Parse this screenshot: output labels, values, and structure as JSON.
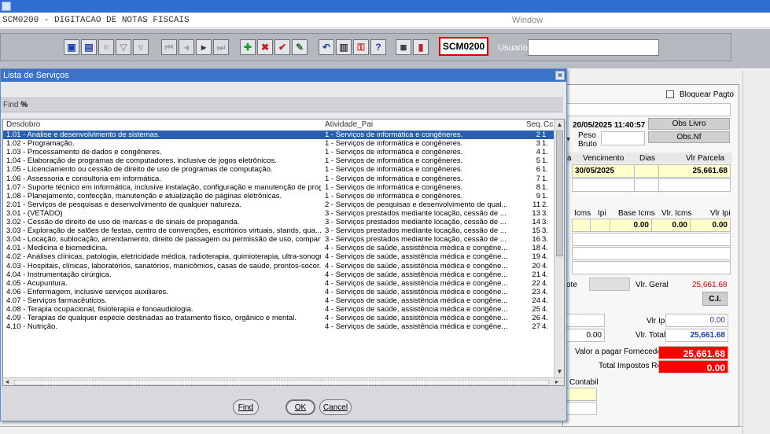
{
  "form": {
    "title": "SCM0200 - DIGITACAO DE NOTAS FISCAIS",
    "window_label": "Window",
    "code": "SCM0200",
    "usuario_label": "Usuario",
    "usuario_value": ""
  },
  "toolbar": {
    "buttons": [
      "save-icon",
      "print-icon",
      "list-icon",
      "filter-icon",
      "funnel-icon",
      "first-icon",
      "prev-icon",
      "next-icon",
      "last-icon",
      "add-icon",
      "delete-icon",
      "confirm-icon",
      "edit-icon",
      "undo-icon",
      "clipboard-icon",
      "key-icon",
      "help-icon",
      "menu-icon",
      "exit-icon"
    ]
  },
  "background": {
    "bloquear_label": "Bloquear Pagto",
    "datetime": "20/05/2025 11:40:57",
    "obs_livro": "Obs Livro",
    "obs_nf": "Obs.Nf",
    "peso": "Peso",
    "bruto": "Bruto",
    "vencimento_header": "Vencimento",
    "dias_header": "Dias",
    "vlr_parcela_header": "Vlr Parcela",
    "vencimento_value": "30/05/2025",
    "vlr_parcela_value": "25,661.68",
    "tax_headers": [
      "Icms",
      "Ipi",
      "Base Icms",
      "Vlr. Icms",
      "Vlr Ipi"
    ],
    "base_icms": "0.00",
    "vlr_icms": "0.00",
    "vlr_ipi_row": "0.00",
    "lote_fragment": "ote",
    "vlr_geral_label": "Vlr. Geral",
    "vlr_geral_value": "25,661.68",
    "ci_button": "C.I.",
    "vlr_ipi_label": "Vlr Ipi",
    "vlr_ipi_value": "0.00",
    "total_left": "0.00",
    "vlr_total_label": "Vlr. Total",
    "vlr_total_value": "25,661.68",
    "valor_pagar_label": "Valor a pagar Fornecedor",
    "valor_pagar_value": "25,661.68",
    "total_impostos_label": "Total Impostos Retido",
    "total_impostos_value": "0.00",
    "contabil_label": "Contabil"
  },
  "dialog": {
    "title": "Lista de Serviços",
    "close_icon": "close-icon",
    "find_label": "Find",
    "find_value": "%",
    "columns": [
      "Desdobro",
      "Atividade_Pai",
      "Seq.",
      "Cc"
    ],
    "rows": [
      {
        "desdobro": "1.01 - Análise e desenvolvimento de sistemas.",
        "atividade": "1 - Serviços de informática e congêneres.",
        "seq": "2",
        "cc": "1"
      },
      {
        "desdobro": "1.02 - Programação.",
        "atividade": "1 - Serviços de informática e congêneres.",
        "seq": "3",
        "cc": "1."
      },
      {
        "desdobro": "1.03 - Processamento de dados e congêneres.",
        "atividade": "1 - Serviços de informática e congêneres.",
        "seq": "4",
        "cc": "1."
      },
      {
        "desdobro": "1.04 - Elaboração de programas de computadores, inclusive de jogos eletrônicos.",
        "atividade": "1 - Serviços de informática e congêneres.",
        "seq": "5",
        "cc": "1."
      },
      {
        "desdobro": "1.05 - Licenciamento ou cessão de direito de uso de programas de computação.",
        "atividade": "1 - Serviços de informática e congêneres.",
        "seq": "6",
        "cc": "1."
      },
      {
        "desdobro": "1.06 - Assessoria e consultoria em informática.",
        "atividade": "1 - Serviços de informática e congêneres.",
        "seq": "7",
        "cc": "1."
      },
      {
        "desdobro": "1.07 - Suporte técnico em informática, inclusive instalação, configuração e manutenção de prog...",
        "atividade": "1 - Serviços de informática e congêneres.",
        "seq": "8",
        "cc": "1."
      },
      {
        "desdobro": "1.08 - Planejamento, confecção, manutenção e atualização de páginas eletrônicas.",
        "atividade": "1 - Serviços de informática e congêneres.",
        "seq": "9",
        "cc": "1."
      },
      {
        "desdobro": "2.01 - Serviços de pesquisas e desenvolvimento de qualquer natureza.",
        "atividade": "2 - Serviços de pesquisas e desenvolvimento de qual...",
        "seq": "11",
        "cc": "2."
      },
      {
        "desdobro": "3.01 - (VETADO)",
        "atividade": "3 - Serviços prestados mediante locação, cessão de ...",
        "seq": "13",
        "cc": "3."
      },
      {
        "desdobro": "3.02 - Cessão de direito de uso de marcas e de sinais de propaganda.",
        "atividade": "3 - Serviços prestados mediante locação, cessão de ...",
        "seq": "14",
        "cc": "3."
      },
      {
        "desdobro": "3.03 - Exploração de salões de festas, centro de convenções, escritórios virtuais, stands, qua...",
        "atividade": "3 - Serviços prestados mediante locação, cessão de ...",
        "seq": "15",
        "cc": "3."
      },
      {
        "desdobro": "3.04 - Locação, sublocação, arrendamento, direito de passagem ou permissão de uso, compart...",
        "atividade": "3 - Serviços prestados mediante locação, cessão de ...",
        "seq": "16",
        "cc": "3."
      },
      {
        "desdobro": "4.01 - Medicina e biomedicina.",
        "atividade": "4 - Serviços de saúde, assistência médica e congêne...",
        "seq": "18",
        "cc": "4."
      },
      {
        "desdobro": "4.02 - Análises clínicas, patologia, eletricidade médica, radioterapia, quimioterapia, ultra-sonogr...",
        "atividade": "4 - Serviços de saúde, assistência médica e congêne...",
        "seq": "19",
        "cc": "4."
      },
      {
        "desdobro": "4.03 - Hospitais, clínicas, laboratórios, sanatórios, manicômios, casas de saúde, prontos-socor...",
        "atividade": "4 - Serviços de saúde, assistência médica e congêne...",
        "seq": "20",
        "cc": "4."
      },
      {
        "desdobro": "4.04 - Instrumentação cirúrgica.",
        "atividade": "4 - Serviços de saúde, assistência médica e congêne...",
        "seq": "21",
        "cc": "4."
      },
      {
        "desdobro": "4.05 - Acupuntura.",
        "atividade": "4 - Serviços de saúde, assistência médica e congêne...",
        "seq": "22",
        "cc": "4."
      },
      {
        "desdobro": "4.06 - Enfermagem, inclusive serviços auxiliares.",
        "atividade": "4 - Serviços de saúde, assistência médica e congêne...",
        "seq": "23",
        "cc": "4."
      },
      {
        "desdobro": "4.07 - Serviços farmacêuticos.",
        "atividade": "4 - Serviços de saúde, assistência médica e congêne...",
        "seq": "24",
        "cc": "4."
      },
      {
        "desdobro": "4.08 - Terapia ocupacional, fisioterapia e fonoaudiologia.",
        "atividade": "4 - Serviços de saúde, assistência médica e congêne...",
        "seq": "25",
        "cc": "4."
      },
      {
        "desdobro": "4.09 - Terapias de qualquer espécie destinadas ao tratamento físico, orgânico e mental.",
        "atividade": "4 - Serviços de saúde, assistência médica e congêne...",
        "seq": "26",
        "cc": "4."
      },
      {
        "desdobro": "4.10 - Nutrição.",
        "atividade": "4 - Serviços de saúde, assistência médica e congêne...",
        "seq": "27",
        "cc": "4."
      }
    ],
    "buttons": {
      "find": "Find",
      "ok": "OK",
      "cancel": "Cancel"
    }
  }
}
